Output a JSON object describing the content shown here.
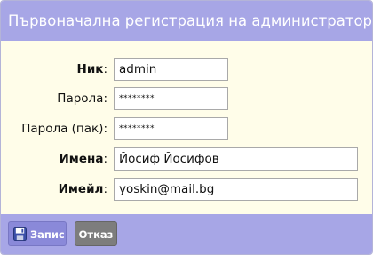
{
  "dialog": {
    "title": "Първоначална регистрация на администратор"
  },
  "form": {
    "nick": {
      "label": "Ник",
      "value": "admin"
    },
    "password": {
      "label": "Парола:",
      "value": "********"
    },
    "password_again": {
      "label": "Парола (пак):",
      "value": "********"
    },
    "names": {
      "label": "Имена",
      "value": "Йосиф Йосифов"
    },
    "email": {
      "label": "Имейл",
      "value": "yoskin@mail.bg"
    }
  },
  "colon": ":",
  "buttons": {
    "save": {
      "label": "Запис",
      "icon": "floppy-disk-icon"
    },
    "cancel": {
      "label": "Отказ"
    }
  },
  "colors": {
    "title_bar": "#a7a6e6",
    "panel": "#fffde9",
    "save_button": "#8a89d9",
    "cancel_button": "#7d7d7d"
  }
}
